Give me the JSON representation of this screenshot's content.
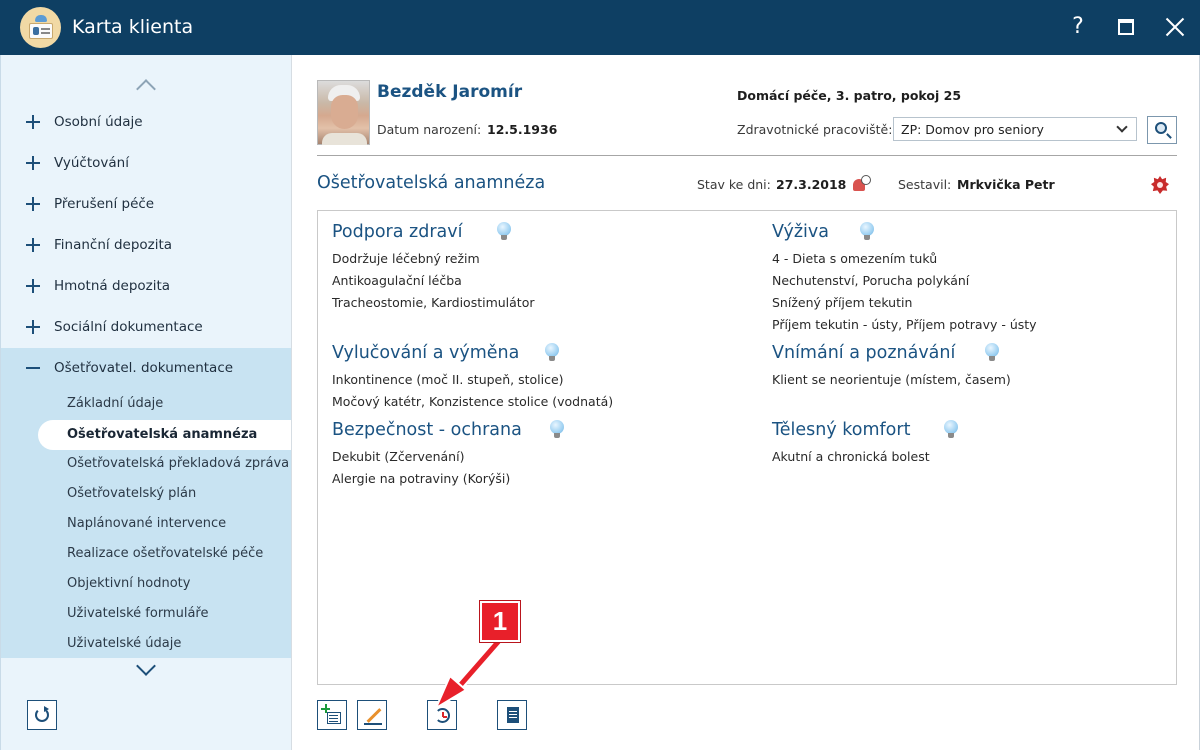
{
  "window": {
    "title": "Karta klienta",
    "help_label": "?"
  },
  "sidebar": {
    "items": [
      {
        "label": "Osobní údaje"
      },
      {
        "label": "Vyúčtování"
      },
      {
        "label": "Přerušení péče"
      },
      {
        "label": "Finanční depozita"
      },
      {
        "label": "Hmotná depozita"
      },
      {
        "label": "Sociální dokumentace"
      },
      {
        "label": "Ošetřovatel. dokumentace"
      }
    ],
    "subitems": [
      {
        "label": "Základní údaje"
      },
      {
        "label": "Ošetřovatelská anamnéza"
      },
      {
        "label": "Ošetřovatelská překladová zpráva"
      },
      {
        "label": "Ošetřovatelský plán"
      },
      {
        "label": "Naplánované intervence"
      },
      {
        "label": "Realizace ošetřovatelské péče"
      },
      {
        "label": "Objektivní hodnoty"
      },
      {
        "label": "Uživatelské formuláře"
      },
      {
        "label": "Uživatelské údaje"
      }
    ],
    "active_subitem": "Ošetřovatelská anamnéza"
  },
  "patient": {
    "name": "Bezděk Jaromír",
    "dob_label": "Datum narození:",
    "dob": "12.5.1936",
    "location": "Domácí péče, 3. patro, pokoj 25",
    "workplace_label": "Zdravotnické pracoviště:",
    "workplace_value": "ZP: Domov pro seniory"
  },
  "section": {
    "title": "Ošetřovatelská anamnéza",
    "state_label": "Stav ke dni:",
    "state_date": "27.3.2018",
    "author_label": "Sestavil:",
    "author": "Mrkvička Petr"
  },
  "blocks": {
    "podpora": {
      "title": "Podpora zdraví",
      "lines": [
        "Dodržuje léčebný režim",
        "Antikoagulační léčba",
        "Tracheostomie, Kardiostimulátor"
      ]
    },
    "vyziva": {
      "title": "Výživa",
      "lines": [
        "4 - Dieta s omezením tuků",
        "Nechutenství, Porucha polykání",
        "Snížený příjem tekutin",
        "Příjem tekutin - ústy, Příjem potravy - ústy"
      ]
    },
    "vylucovani": {
      "title": "Vylučování a výměna",
      "lines": [
        "Inkontinence (moč II. stupeň, stolice)",
        "Močový katétr, Konzistence stolice (vodnatá)"
      ]
    },
    "vnimani": {
      "title": "Vnímání a poznávání",
      "lines": [
        "Klient se neorientuje (místem, časem)"
      ]
    },
    "bezpecnost": {
      "title": "Bezpečnost - ochrana",
      "lines": [
        "Dekubit (Zčervenání)",
        "Alergie na potraviny (Korýši)"
      ]
    },
    "komfort": {
      "title": "Tělesný komfort",
      "lines": [
        "Akutní a chronická bolest"
      ]
    }
  },
  "annotation": {
    "number": "1",
    "color": "#e8202a"
  },
  "colors": {
    "titlebar": "#0e3f63",
    "accent": "#1b5382",
    "sidebar_bg": "#eaf4fb",
    "sidebar_expanded": "#c8e3f2"
  }
}
